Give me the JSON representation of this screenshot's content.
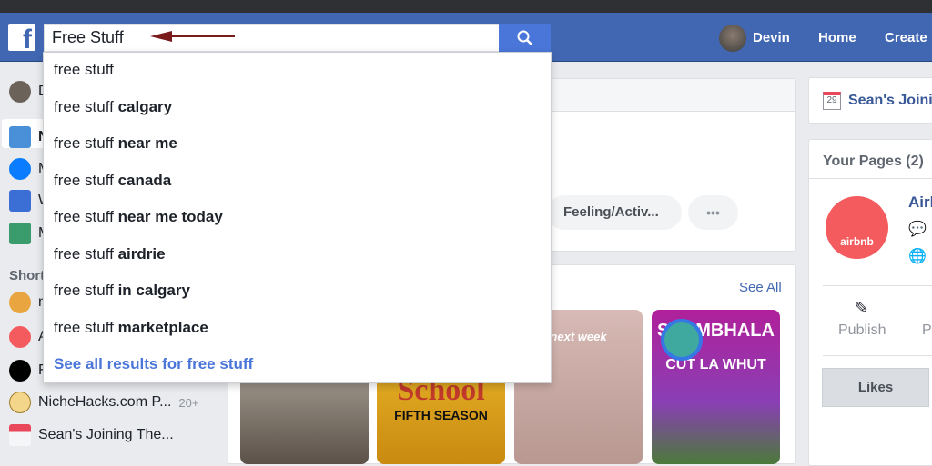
{
  "header": {
    "logo": "f",
    "search_value": "Free Stuff",
    "user_name": "Devin",
    "nav": [
      "Home",
      "Create"
    ]
  },
  "sidebar": {
    "user_initial": "D",
    "items": [
      {
        "icon": "news-feed-icon",
        "label": "N"
      },
      {
        "icon": "messenger-icon",
        "label": "M"
      },
      {
        "icon": "watch-icon",
        "label": "W"
      },
      {
        "icon": "marketplace-icon",
        "label": "M"
      }
    ],
    "shortcuts_heading": "Short",
    "shortcuts": [
      {
        "label": "m",
        "count": ""
      },
      {
        "label": "A",
        "count": ""
      },
      {
        "label": "F",
        "count": ""
      },
      {
        "label": "NicheHacks.com P...",
        "count": "20+"
      },
      {
        "label": "Sean's Joining The...",
        "count": ""
      }
    ]
  },
  "search_dropdown": {
    "prefix": "free stuff",
    "suggestions": [
      "",
      "calgary",
      "near me",
      "canada",
      "near me today",
      "airdrie",
      "in calgary",
      "marketplace"
    ],
    "see_all": "See all results for free stuff"
  },
  "composer": {
    "feeling": "Feeling/Activ...",
    "more": "•••"
  },
  "stories": {
    "see_all": "See All",
    "cards": [
      {
        "text": "School",
        "sub": "FIFTH SEASON"
      },
      {
        "text": "",
        "sub": "next week"
      },
      {
        "text": "SHAMBHALA",
        "sub": "CUT LA WHUT"
      }
    ]
  },
  "right": {
    "event": "Sean's Joini",
    "event_day": "29",
    "pages_title": "Your Pages (2)",
    "page_name": "Airl",
    "page_logo": "airbnb",
    "publish": "Publish",
    "publish2": "P",
    "likes_tab": "Likes"
  },
  "colors": {
    "brand": "#4267b2",
    "link": "#4a76d9",
    "airbnb": "#f45b5e"
  }
}
